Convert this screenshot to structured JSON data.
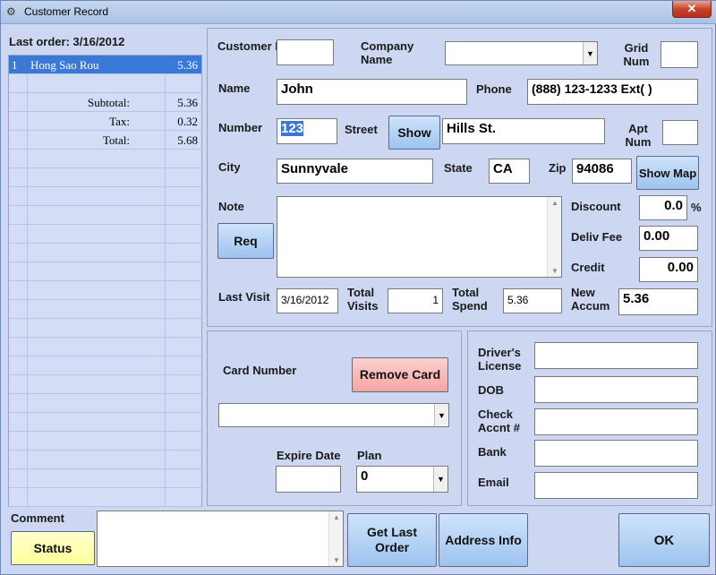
{
  "window": {
    "title": "Customer Record",
    "close": "✕"
  },
  "last_order": {
    "header": "Last order: 3/16/2012",
    "items": [
      {
        "qty": "1",
        "name": "Hong Sao Rou",
        "price": "5.36"
      }
    ],
    "subtotal_label": "Subtotal:",
    "subtotal": "5.36",
    "tax_label": "Tax:",
    "tax": "0.32",
    "total_label": "Total:",
    "total": "5.68"
  },
  "customer": {
    "id_label": "Customer ID",
    "id_value": "",
    "company_label": "Company Name",
    "company_value": "",
    "grid_label": "Grid Num",
    "grid_value": "",
    "name_label": "Name",
    "name_value": "John",
    "phone_label": "Phone",
    "phone_value": "(888) 123-1233 Ext(      )",
    "number_label": "Number",
    "number_value": "123",
    "street_label": "Street",
    "show_button": "Show",
    "street_value": "Hills St.",
    "apt_label": "Apt Num",
    "apt_value": "",
    "city_label": "City",
    "city_value": "Sunnyvale",
    "state_label": "State",
    "state_value": "CA",
    "zip_label": "Zip",
    "zip_value": "94086",
    "show_map_button": "Show Map",
    "note_label": "Note",
    "req_button": "Req",
    "note_value": "",
    "discount_label": "Discount",
    "discount_value": "0.0",
    "discount_unit": "%",
    "deliv_fee_label": "Deliv Fee",
    "deliv_fee_value": "0.00",
    "credit_label": "Credit",
    "credit_value": "0.00",
    "last_visit_label": "Last Visit",
    "last_visit_value": "3/16/2012",
    "total_visits_label": "Total Visits",
    "total_visits_value": "1",
    "total_spend_label": "Total Spend",
    "total_spend_value": "5.36",
    "new_accum_label": "New Accum",
    "new_accum_value": "5.36"
  },
  "card": {
    "card_number_label": "Card Number",
    "remove_card_button": "Remove Card",
    "card_number_value": "",
    "expire_label": "Expire Date",
    "expire_value": "",
    "plan_label": "Plan",
    "plan_value": "0"
  },
  "payment": {
    "drivers_label": "Driver's License",
    "drivers_value": "",
    "dob_label": "DOB",
    "dob_value": "",
    "check_label": "Check Accnt #",
    "check_value": "",
    "bank_label": "Bank",
    "bank_value": "",
    "email_label": "Email",
    "email_value": ""
  },
  "footer": {
    "comment_label": "Comment",
    "status_button": "Status",
    "comment_value": "",
    "get_last_order_button": "Get Last Order",
    "address_info_button": "Address Info",
    "ok_button": "OK"
  },
  "colors": {
    "selection": "#3b79d6",
    "remove_card": "#f7b3b0",
    "status": "#ffffa8",
    "buttons": "#a8c9f0"
  }
}
